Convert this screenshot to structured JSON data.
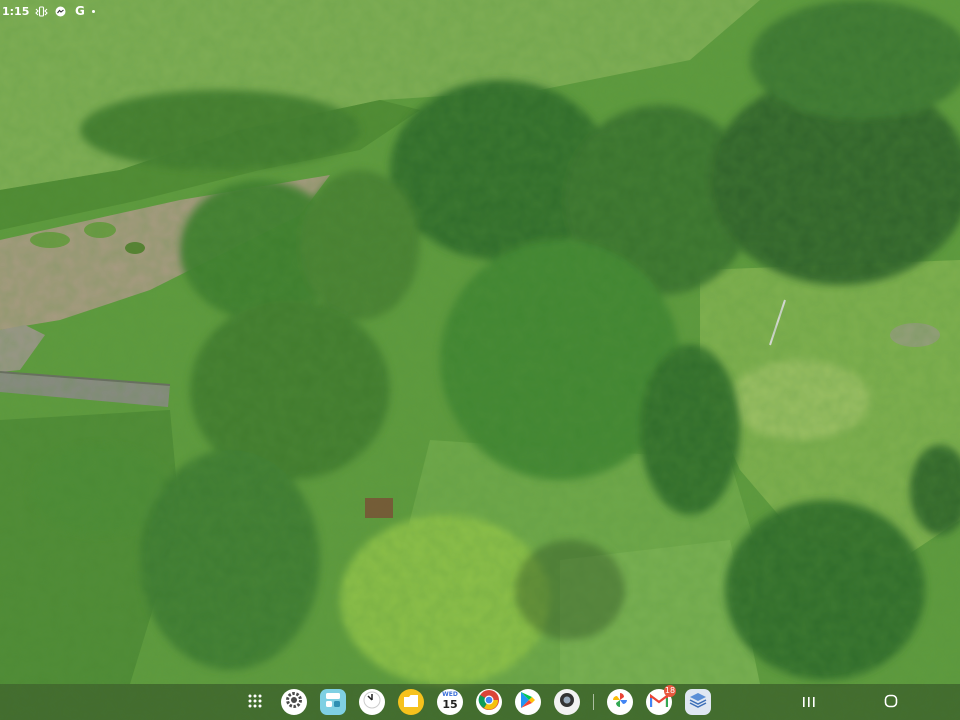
{
  "status_bar": {
    "time": "1:15",
    "icons": [
      "vibrate-icon",
      "messenger-icon",
      "google-icon",
      "notification-dot"
    ]
  },
  "taskbar": {
    "apps": [
      {
        "name": "app-drawer",
        "icon": "grid-icon"
      },
      {
        "name": "settings",
        "icon": "gear-icon"
      },
      {
        "name": "app-pair",
        "icon": "multi-window-icon"
      },
      {
        "name": "clock",
        "icon": "clock-icon"
      },
      {
        "name": "my-files",
        "icon": "folder-icon"
      },
      {
        "name": "calendar",
        "icon": "calendar-icon",
        "day_label": "WED",
        "day_number": "15"
      },
      {
        "name": "chrome",
        "icon": "chrome-icon"
      },
      {
        "name": "play-store",
        "icon": "play-store-icon"
      },
      {
        "name": "camera",
        "icon": "camera-icon"
      },
      {
        "name": "photos",
        "icon": "pinwheel-icon"
      },
      {
        "name": "gmail",
        "icon": "gmail-icon",
        "badge": "18"
      },
      {
        "name": "files",
        "icon": "stack-icon"
      }
    ]
  },
  "nav_bar": {
    "buttons": [
      {
        "name": "recents",
        "icon": "recents-icon"
      },
      {
        "name": "home",
        "icon": "home-icon"
      }
    ]
  },
  "colors": {
    "grass": "#6fa84a",
    "tree_dark": "#2f6b2a",
    "tree_light": "#7fbf3f",
    "taskbar": "#1e2d1e"
  }
}
